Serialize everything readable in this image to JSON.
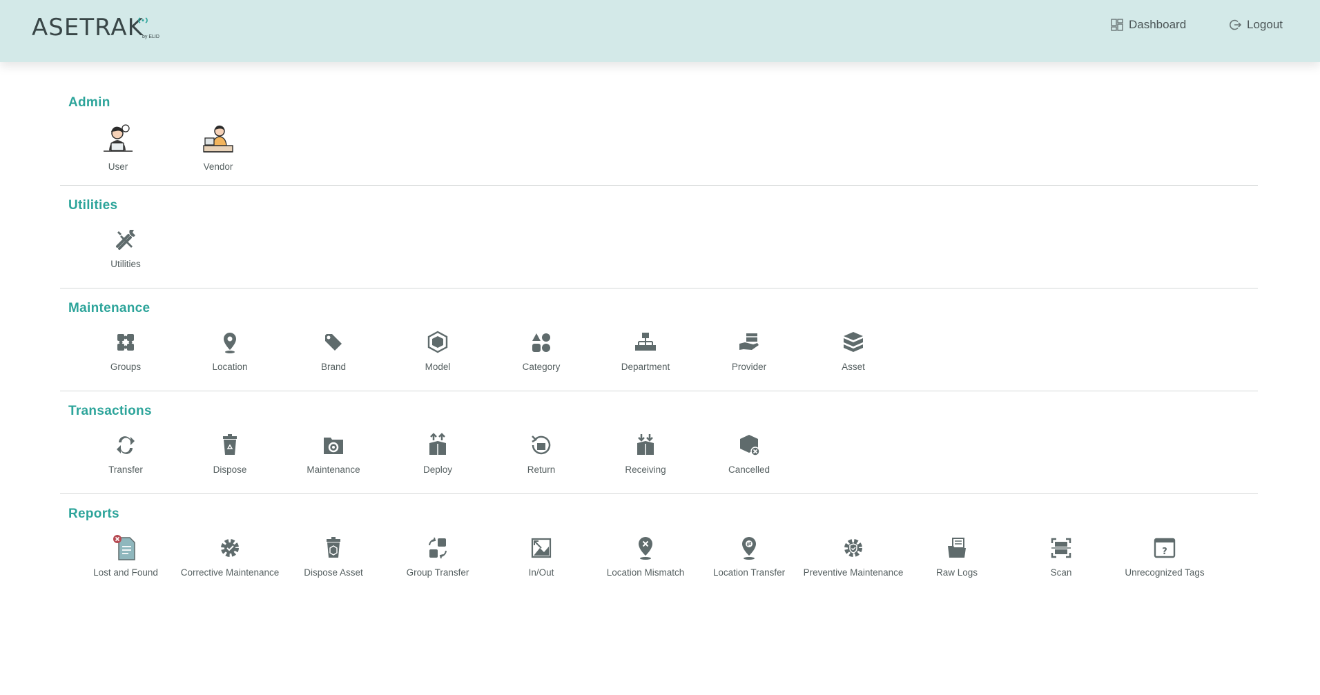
{
  "header": {
    "logo_text": "ASETRAK",
    "logo_sub": "by ELID",
    "nav": {
      "dashboard": "Dashboard",
      "logout": "Logout"
    }
  },
  "colors": {
    "accent": "#2ca49a",
    "header_bg": "#d3e9e8",
    "icon": "#5f6b6c"
  },
  "sections": {
    "admin": {
      "title": "Admin",
      "items": [
        {
          "label": "User",
          "icon": "user-at-laptop-icon"
        },
        {
          "label": "Vendor",
          "icon": "vendor-cashier-icon"
        }
      ]
    },
    "utilities": {
      "title": "Utilities",
      "items": [
        {
          "label": "Utilities",
          "icon": "tools-icon"
        }
      ]
    },
    "maintenance": {
      "title": "Maintenance",
      "items": [
        {
          "label": "Groups",
          "icon": "puzzle-icon"
        },
        {
          "label": "Location",
          "icon": "map-pin-icon"
        },
        {
          "label": "Brand",
          "icon": "tag-icon"
        },
        {
          "label": "Model",
          "icon": "cube-icon"
        },
        {
          "label": "Category",
          "icon": "shapes-icon"
        },
        {
          "label": "Department",
          "icon": "org-chart-icon"
        },
        {
          "label": "Provider",
          "icon": "hand-box-icon"
        },
        {
          "label": "Asset",
          "icon": "open-box-icon"
        }
      ]
    },
    "transactions": {
      "title": "Transactions",
      "items": [
        {
          "label": "Transfer",
          "icon": "swap-arrows-icon"
        },
        {
          "label": "Dispose",
          "icon": "recycle-bin-icon"
        },
        {
          "label": "Maintenance",
          "icon": "gear-folder-icon"
        },
        {
          "label": "Deploy",
          "icon": "box-up-arrows-icon"
        },
        {
          "label": "Return",
          "icon": "box-return-icon"
        },
        {
          "label": "Receiving",
          "icon": "box-down-arrows-icon"
        },
        {
          "label": "Cancelled",
          "icon": "box-cancel-icon"
        }
      ]
    },
    "reports": {
      "title": "Reports",
      "items": [
        {
          "label": "Lost and Found",
          "icon": "document-x-icon"
        },
        {
          "label": "Corrective Maintenance",
          "icon": "gear-check-icon"
        },
        {
          "label": "Dispose Asset",
          "icon": "trash-box-icon"
        },
        {
          "label": "Group Transfer",
          "icon": "puzzle-arrows-icon"
        },
        {
          "label": "In/Out",
          "icon": "in-out-image-icon"
        },
        {
          "label": "Location Mismatch",
          "icon": "pin-x-icon"
        },
        {
          "label": "Location Transfer",
          "icon": "pin-transfer-icon"
        },
        {
          "label": "Preventive Maintenance",
          "icon": "gear-shield-icon"
        },
        {
          "label": "Raw Logs",
          "icon": "folder-docs-icon"
        },
        {
          "label": "Scan",
          "icon": "scan-icon"
        },
        {
          "label": "Unrecognized Tags",
          "icon": "question-window-icon"
        }
      ]
    }
  }
}
